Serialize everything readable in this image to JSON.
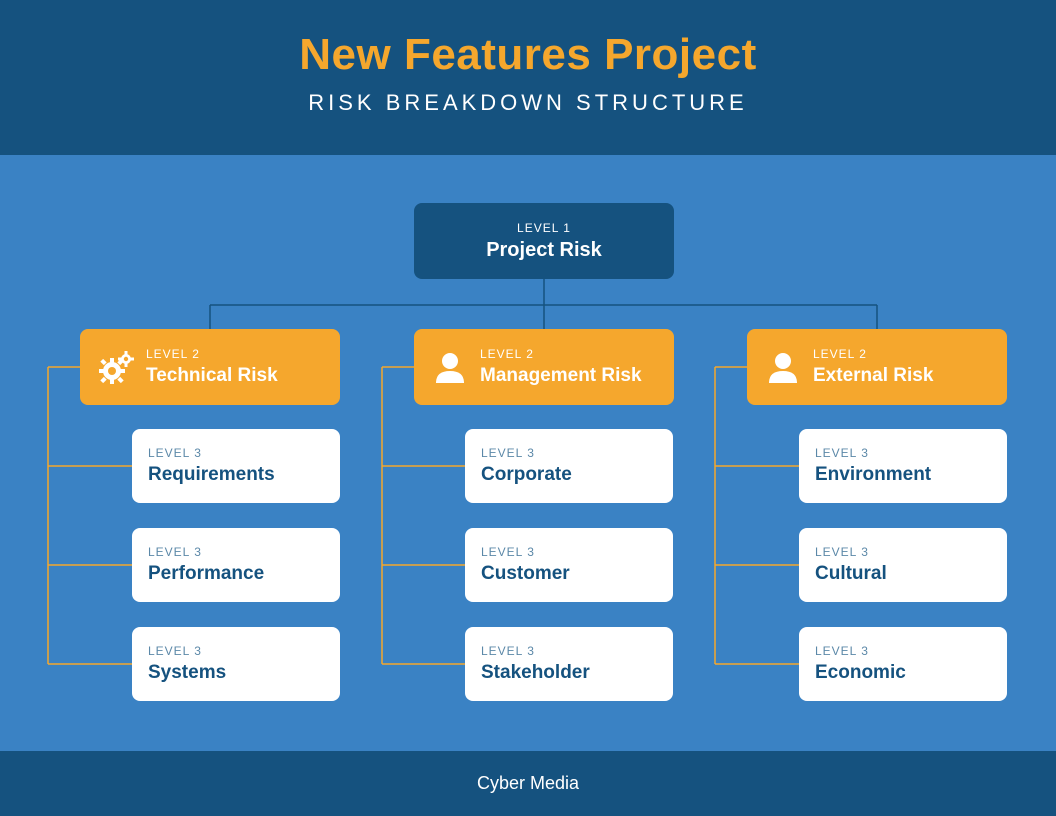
{
  "header": {
    "title": "New Features Project",
    "subtitle": "RISK BREAKDOWN STRUCTURE"
  },
  "footer": "Cyber Media",
  "levels": {
    "l1": "LEVEL 1",
    "l2": "LEVEL 2",
    "l3": "LEVEL 3"
  },
  "root": {
    "title": "Project Risk"
  },
  "categories": [
    {
      "title": "Technical Risk",
      "icon": "gears-icon",
      "items": [
        "Requirements",
        "Performance",
        "Systems"
      ]
    },
    {
      "title": "Management Risk",
      "icon": "person-icon",
      "items": [
        "Corporate",
        "Customer",
        "Stakeholder"
      ]
    },
    {
      "title": "External Risk",
      "icon": "person-icon",
      "items": [
        "Environment",
        "Cultural",
        "Economic"
      ]
    }
  ]
}
